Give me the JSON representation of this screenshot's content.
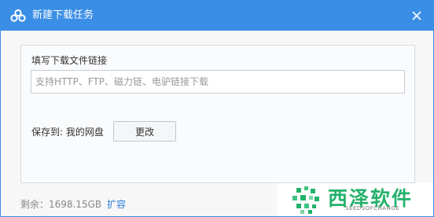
{
  "window": {
    "title": "新建下载任务",
    "accent_color": "#3a8ee6",
    "icon": "baidu-cloud-icon"
  },
  "form": {
    "url_label": "填写下载文件链接",
    "url_placeholder": "支持HTTP、FTP、磁力链、电驴链接下载",
    "url_value": "",
    "save_to_label": "保存到: 我的网盘",
    "change_button": "更改"
  },
  "footer": {
    "remaining": "剩余：1698.15GB",
    "expand_link": "扩容"
  },
  "watermark": {
    "text": "西泽软件",
    "subtext": "SEEDSOFCHANGE"
  }
}
